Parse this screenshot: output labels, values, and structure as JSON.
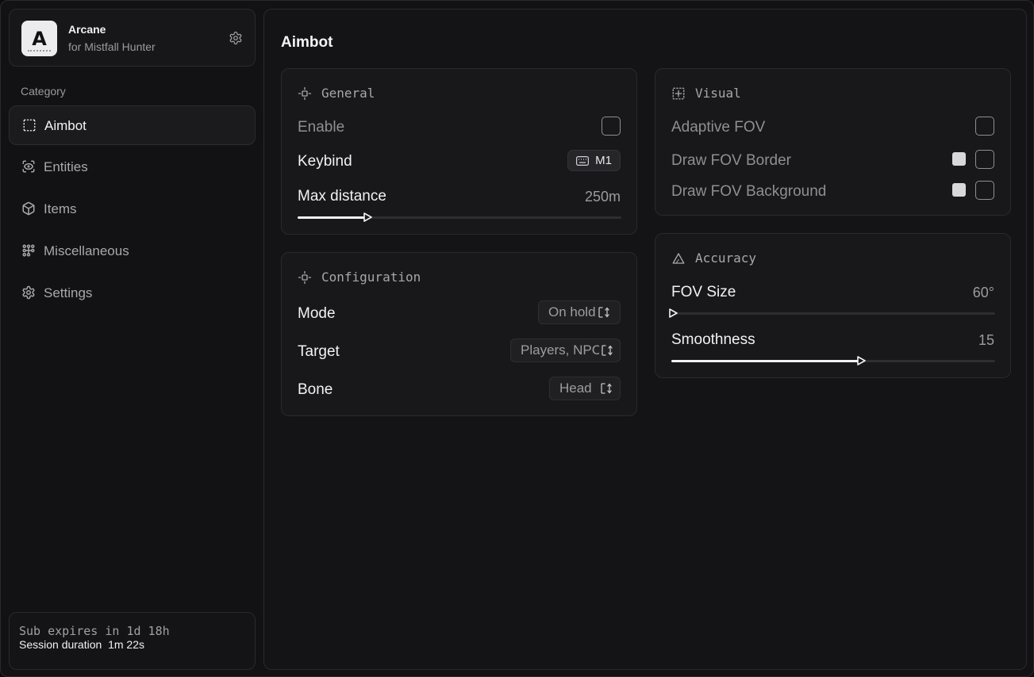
{
  "brand": {
    "logo_letter": "A",
    "name": "Arcane",
    "subtitle": "for Mistfall Hunter"
  },
  "sidebar": {
    "category_label": "Category",
    "items": [
      {
        "label": "Aimbot",
        "icon": "dashed-square-icon",
        "active": true
      },
      {
        "label": "Entities",
        "icon": "scan-eye-icon",
        "active": false
      },
      {
        "label": "Items",
        "icon": "cube-icon",
        "active": false
      },
      {
        "label": "Miscellaneous",
        "icon": "grid-nodes-icon",
        "active": false
      },
      {
        "label": "Settings",
        "icon": "gear-icon",
        "active": false
      }
    ]
  },
  "footer": {
    "sub_expires": "Sub expires in 1d 18h",
    "session": "Session duration  1m 22s"
  },
  "main": {
    "title": "Aimbot",
    "general": {
      "title": "General",
      "enable_label": "Enable",
      "enable_checked": false,
      "keybind_label": "Keybind",
      "keybind_value": "M1",
      "max_distance_label": "Max distance",
      "max_distance_value": "250m",
      "max_distance_fraction": 0.21
    },
    "configuration": {
      "title": "Configuration",
      "mode_label": "Mode",
      "mode_value": "On hold",
      "target_label": "Target",
      "target_value": "Players, NPCs",
      "bone_label": "Bone",
      "bone_value": "Head"
    },
    "visual": {
      "title": "Visual",
      "adaptive_fov_label": "Adaptive FOV",
      "draw_fov_border_label": "Draw FOV Border",
      "draw_fov_background_label": "Draw FOV Background",
      "border_color": "#d8d8da",
      "background_color": "#d8d8da"
    },
    "accuracy": {
      "title": "Accuracy",
      "fov_size_label": "FOV Size",
      "fov_size_value": "60°",
      "fov_size_fraction": 0.0,
      "smoothness_label": "Smoothness",
      "smoothness_value": "15",
      "smoothness_fraction": 0.58
    }
  }
}
